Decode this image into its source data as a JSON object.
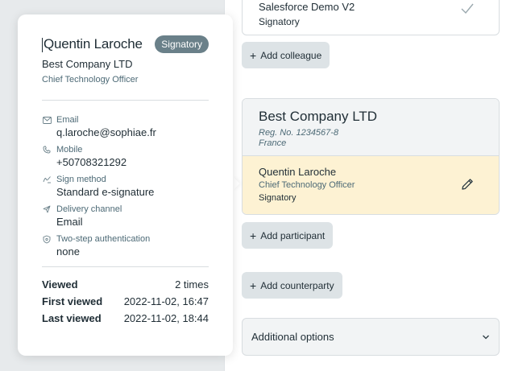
{
  "popover": {
    "name": "Quentin Laroche",
    "role_badge": "Signatory",
    "company": "Best Company LTD",
    "title": "Chief Technology Officer",
    "fields": [
      {
        "label": "Email",
        "value": "q.laroche@sophiae.fr",
        "icon": "mail-icon"
      },
      {
        "label": "Mobile",
        "value": "+50708321292",
        "icon": "phone-icon"
      },
      {
        "label": "Sign method",
        "value": "Standard e-signature",
        "icon": "signature-icon"
      },
      {
        "label": "Delivery channel",
        "value": "Email",
        "icon": "send-icon"
      },
      {
        "label": "Two-step authentication",
        "value": "none",
        "icon": "shield-icon"
      }
    ],
    "stats": [
      {
        "key": "Viewed",
        "value": "2 times"
      },
      {
        "key": "First viewed",
        "value": "2022-11-02, 16:47"
      },
      {
        "key": "Last viewed",
        "value": "2022-11-02, 18:44"
      }
    ]
  },
  "top_participant": {
    "name": "Salesforce Demo V2",
    "role": "Signatory"
  },
  "buttons": {
    "add_colleague": "Add colleague",
    "add_participant": "Add participant",
    "add_counterparty": "Add counterparty"
  },
  "counterparty": {
    "name": "Best Company LTD",
    "reg_no": "Reg. No. 1234567-8",
    "country": "France",
    "participant": {
      "name": "Quentin Laroche",
      "title": "Chief Technology Officer",
      "role": "Signatory"
    }
  },
  "additional_options": {
    "label": "Additional options"
  },
  "colors": {
    "badge": "#6a8089",
    "highlight": "#fdf2d3",
    "button_bg": "#dde3e6"
  }
}
